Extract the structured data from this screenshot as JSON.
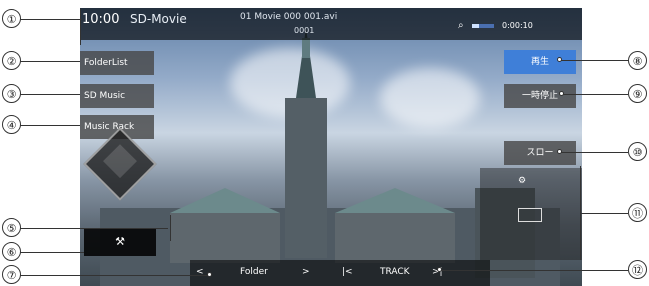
{
  "status": {
    "time": "10:00",
    "source": "SD-Movie",
    "filename": "01 Movie 000 001.avi",
    "track_code": "0001",
    "elapsed": "0:00:10",
    "progress_fraction": 0.3
  },
  "left_buttons": [
    {
      "label": "FolderList"
    },
    {
      "label": "SD Music"
    },
    {
      "label": "Music Rack"
    }
  ],
  "right_buttons": {
    "play": "再生",
    "pause": "一時停止",
    "slow": "スロー"
  },
  "bottom_bar": {
    "prev_folder": "<",
    "folder": "Folder",
    "next_folder": ">",
    "prev_track": "|<",
    "track": "TRACK",
    "next_track": ">|"
  },
  "callouts": [
    "①",
    "②",
    "③",
    "④",
    "⑤",
    "⑥",
    "⑦",
    "⑧",
    "⑨",
    "⑩",
    "⑪",
    "⑫"
  ],
  "colors": {
    "play_button": "#3f7fd8",
    "status_bar": "#000000"
  }
}
